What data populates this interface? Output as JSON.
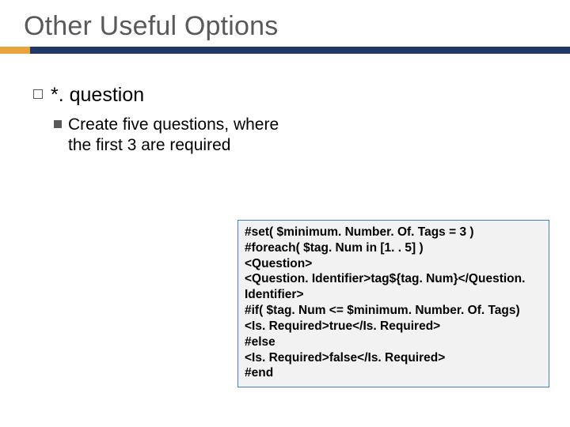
{
  "title": "Other Useful Options",
  "bullet1": "*. question",
  "bullet2_prefix": "Create ",
  "bullet2_rest": "five questions, where the first 3 are required",
  "code": {
    "l1": "#set( $minimum. Number. Of. Tags = 3 )",
    "l2": "#foreach( $tag. Num in [1. . 5] )",
    "l3": "<Question>",
    "l4": "<Question. Identifier>tag${tag. Num}</Question. Identifier>",
    "l5": "#if( $tag. Num <= $minimum. Number. Of. Tags)",
    "l6": "<Is. Required>true</Is. Required>",
    "l7": "#else",
    "l8": "<Is. Required>false</Is. Required>",
    "l9": "#end"
  }
}
